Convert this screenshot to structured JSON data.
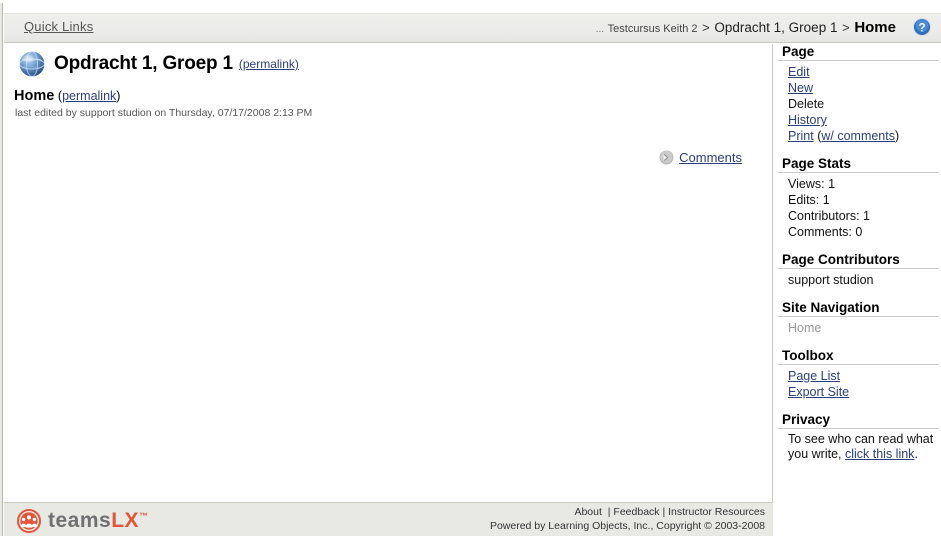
{
  "header": {
    "quick_links_label": "Quick Links",
    "breadcrumb": {
      "ellipsis": "...",
      "ancestor": "Testcursus Keith 2",
      "separator": ">",
      "parent": "Opdracht 1, Groep 1",
      "current": "Home"
    },
    "help_icon": "help-question-icon"
  },
  "main": {
    "site_icon": "globe-icon",
    "site_title": "Opdracht 1, Groep 1",
    "site_permalink_label": "(permalink)",
    "page_heading": "Home",
    "page_permalink_open": "(",
    "page_permalink_label": "permalink",
    "page_permalink_close": ")",
    "last_edited": "last edited by support studion on Thursday, 07/17/2008 2:13 PM",
    "comments_icon": "arrow-right-circle-icon",
    "comments_label": "Comments"
  },
  "sidebar": {
    "page": {
      "title": "Page",
      "items": [
        {
          "label": "Edit",
          "link": true
        },
        {
          "label": "New",
          "link": true
        },
        {
          "label": "Delete",
          "link": false
        },
        {
          "label": "History",
          "link": true
        }
      ],
      "print_label": "Print",
      "print_open": "(",
      "print_comments_label": "w/ comments",
      "print_close": ")"
    },
    "page_stats": {
      "title": "Page Stats",
      "rows": [
        "Views: 1",
        "Edits: 1",
        "Contributors: 1",
        "Comments: 0"
      ]
    },
    "page_contributors": {
      "title": "Page Contributors",
      "items": [
        "support studion"
      ]
    },
    "site_navigation": {
      "title": "Site Navigation",
      "items": [
        "Home"
      ]
    },
    "toolbox": {
      "title": "Toolbox",
      "items": [
        "Page List",
        "Export Site"
      ]
    },
    "privacy": {
      "title": "Privacy",
      "text_before": "To see who can read what you write, ",
      "link_label": "click this link",
      "text_after": "."
    }
  },
  "footer": {
    "logo_icon": "teamslx-people-circle-icon",
    "logo_text_main": "teams",
    "logo_text_accent": "LX",
    "logo_trademark": "™",
    "links": [
      "About",
      "Feedback",
      "Instructor Resources"
    ],
    "separator": "|",
    "copyright": "Powered by Learning Objects, Inc., Copyright © 2003-2008"
  },
  "colors": {
    "link": "#2b3f7a",
    "header_bg": "#ececeb",
    "footer_bg": "#e9e9e4",
    "accent_orange": "#e0553b",
    "muted": "#999999"
  }
}
